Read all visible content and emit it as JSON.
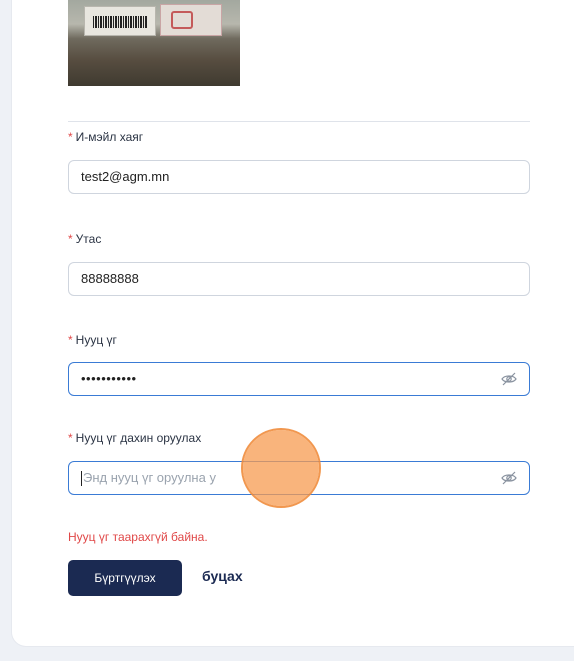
{
  "form": {
    "email": {
      "label": "И-мэйл хаяг",
      "required_mark": "*",
      "value": "test2@agm.mn"
    },
    "phone": {
      "label": "Утас",
      "required_mark": "*",
      "value": "88888888"
    },
    "password": {
      "label": "Нууц үг",
      "required_mark": "*",
      "value": "•••••••••••"
    },
    "password_confirm": {
      "label": "Нууц үг дахин оруулах",
      "required_mark": "*",
      "placeholder": "Энд нууц үг оруулна у"
    },
    "error_message": "Нууц үг таарахгүй байна.",
    "register_label": "Бүртгүүлэх",
    "back_label": "буцах"
  },
  "icons": {
    "password_toggle": "eye-slash-icon"
  },
  "colors": {
    "primary": "#1b2a52",
    "error": "#e04848",
    "focus": "#3a7bd5"
  }
}
